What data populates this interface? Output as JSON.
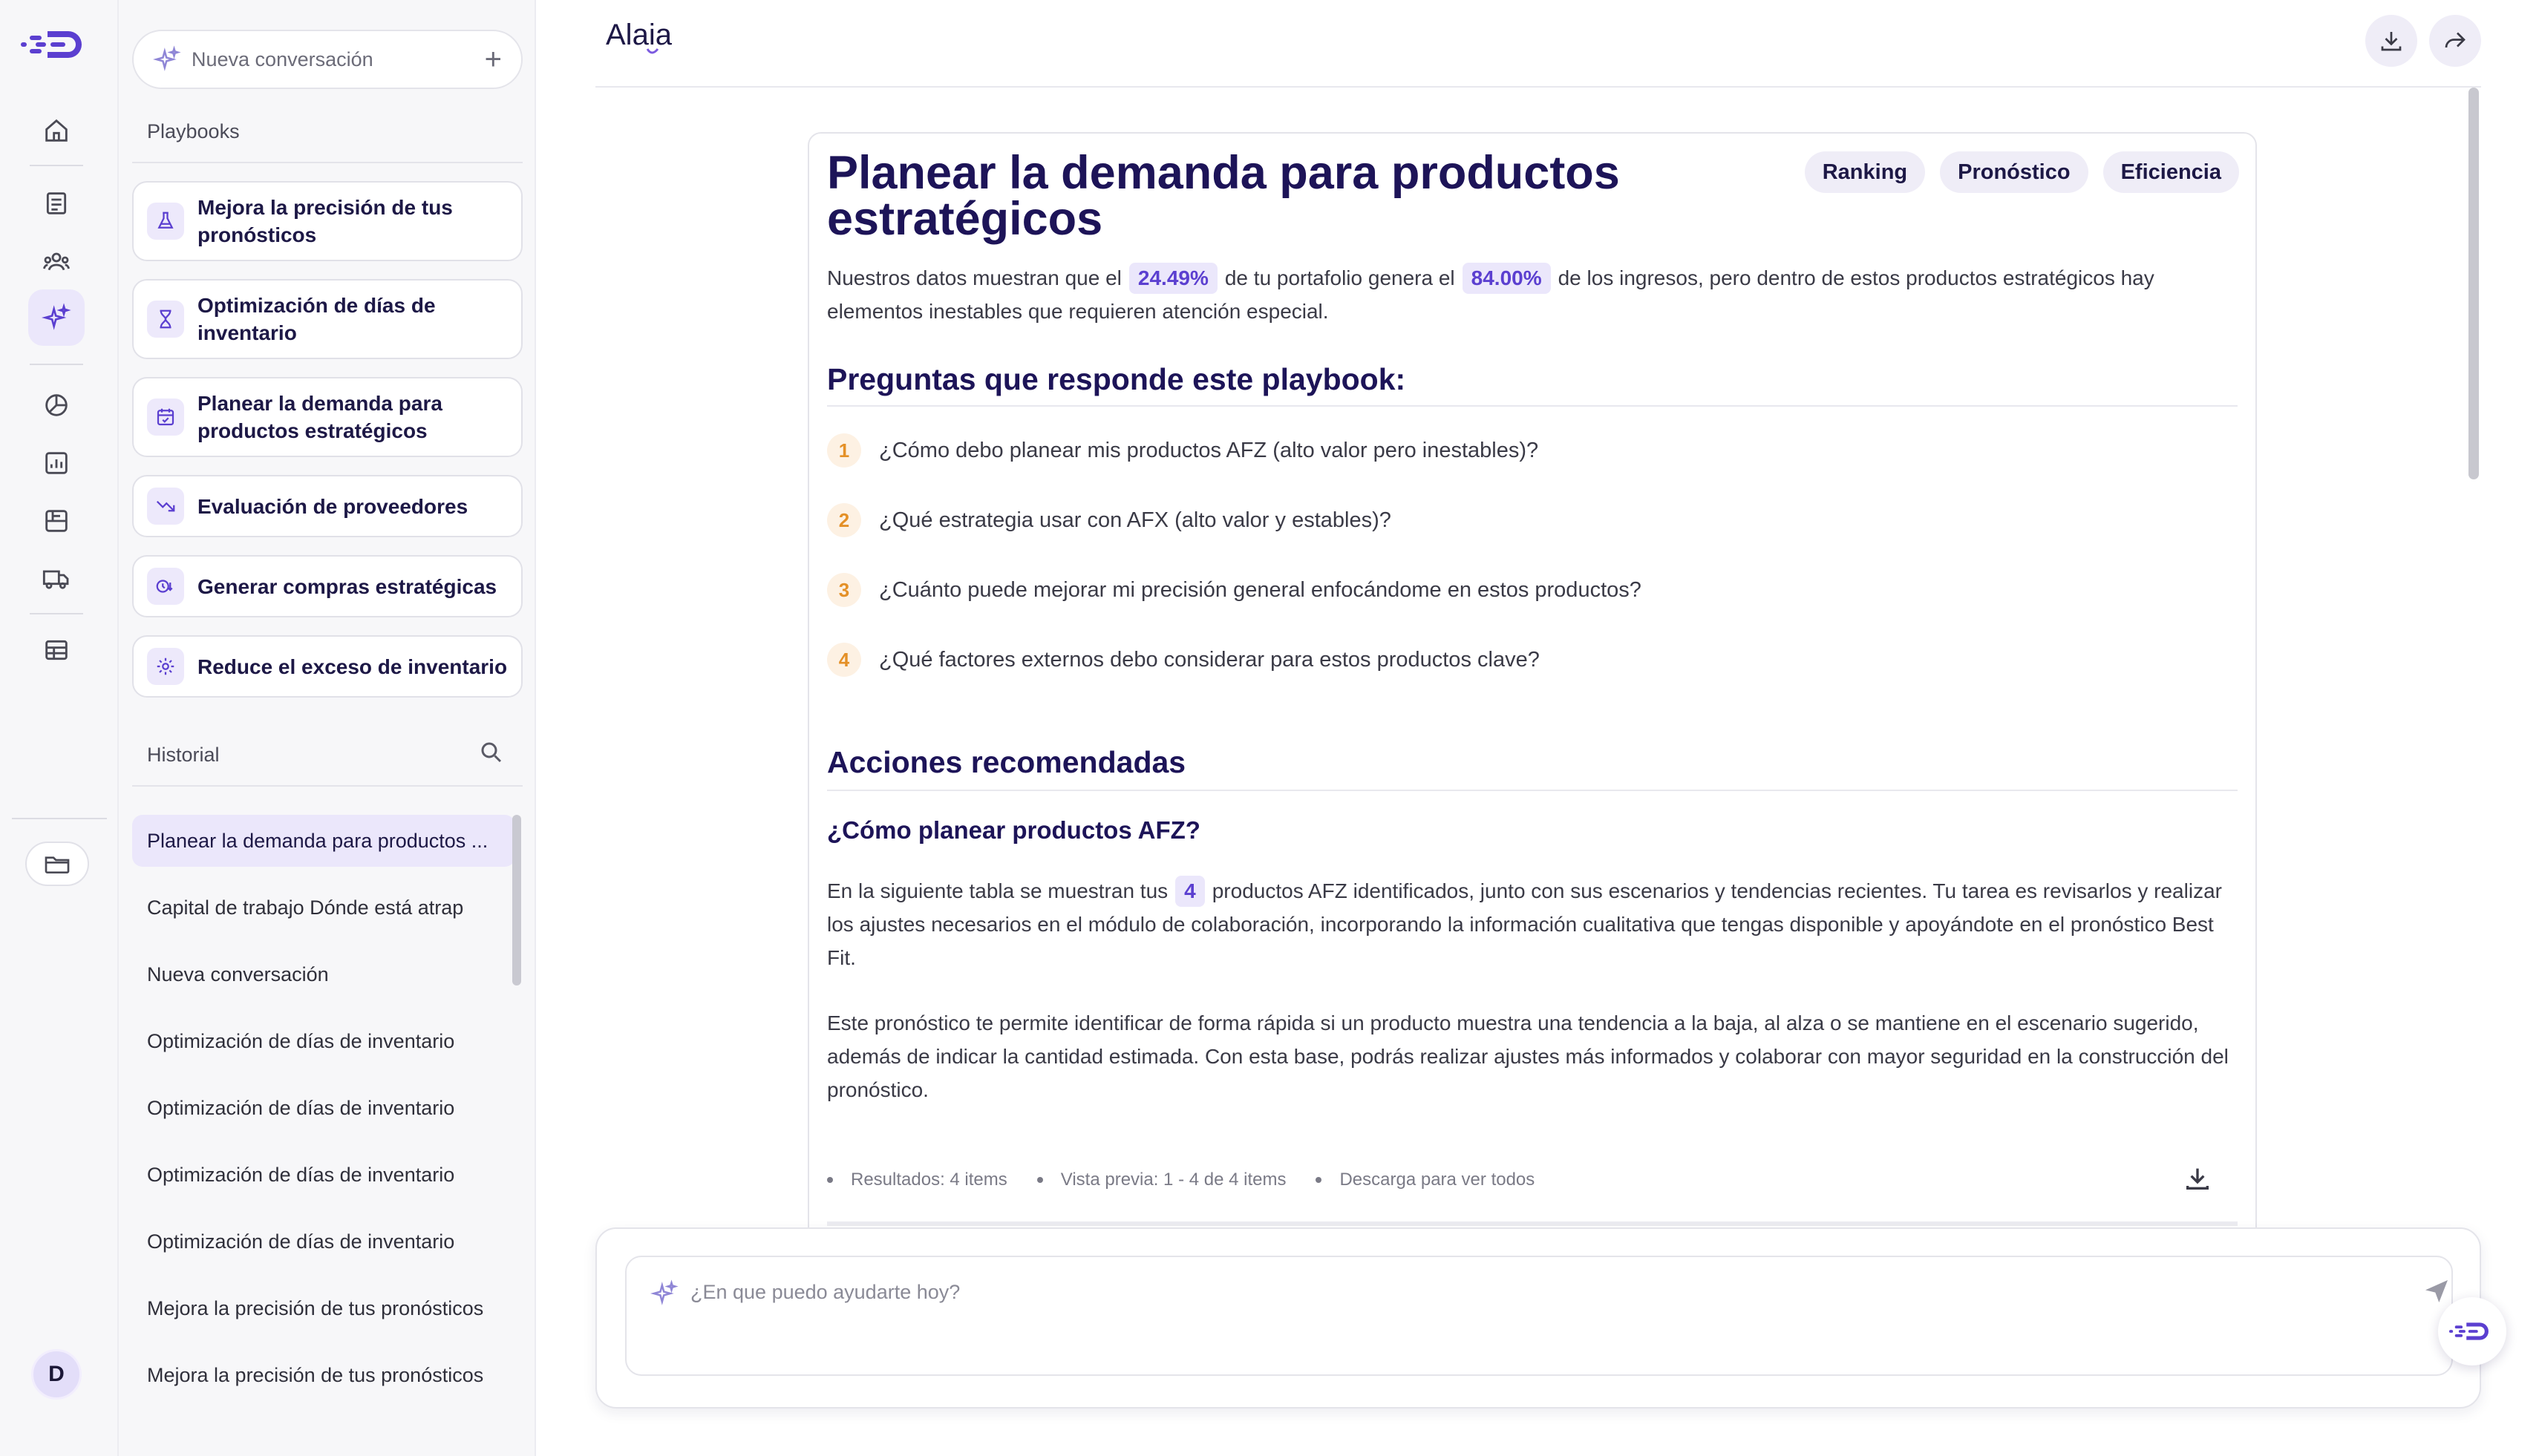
{
  "brand": {
    "app_logo": "Alaia",
    "accent": "#5b3fd0",
    "title_color": "#1d1458"
  },
  "rail": {
    "items": [
      "home-icon",
      "document-icon",
      "users-icon",
      "sparkles-icon",
      "chart-pie-icon",
      "bar-chart-icon",
      "catalog-icon",
      "truck-icon",
      "table-icon"
    ],
    "active": "sparkles-icon",
    "avatar_initial": "D"
  },
  "sidebar": {
    "new_chat_label": "Nueva conversación",
    "playbooks_title": "Playbooks",
    "playbooks": [
      {
        "label": "Mejora la precisión de tus pronósticos",
        "icon": "flask-icon"
      },
      {
        "label": "Optimización de días de inventario",
        "icon": "hourglass-icon"
      },
      {
        "label": "Planear la demanda para productos estratégicos",
        "icon": "calendar-check-icon"
      },
      {
        "label": "Evaluación de proveedores",
        "icon": "trend-down-icon"
      },
      {
        "label": "Generar compras estratégicas",
        "icon": "clock-money-icon"
      },
      {
        "label": "Reduce el exceso de inventario",
        "icon": "gear-icon"
      }
    ],
    "history_title": "Historial",
    "history": [
      "Planear la demanda para productos ...",
      "Capital de trabajo Dónde está atrap",
      "Nueva conversación",
      "Optimización de días de inventario",
      "Optimización de días de inventario",
      "Optimización de días de inventario",
      "Optimización de días de inventario",
      "Mejora la precisión de tus pronósticos",
      "Mejora la precisión de tus pronósticos"
    ]
  },
  "main": {
    "title": "Planear la demanda para productos estratégicos",
    "tags": [
      "Ranking",
      "Pronóstico",
      "Eficiencia"
    ],
    "intro": {
      "p1": "Nuestros datos muestran que el",
      "v1": "24.49%",
      "p2": "de tu portafolio genera el",
      "v2": "84.00%",
      "p3": "de los ingresos, pero dentro de estos productos estratégicos hay elementos inestables que requieren atención especial."
    },
    "questions_title": "Preguntas que responde este playbook:",
    "questions": [
      {
        "num": "1",
        "text": "¿Cómo debo planear mis productos AFZ (alto valor pero inestables)?"
      },
      {
        "num": "2",
        "text": "¿Qué estrategia usar con AFX (alto valor y estables)?"
      },
      {
        "num": "3",
        "text": "¿Cuánto puede mejorar mi precisión general enfocándome en estos productos?"
      },
      {
        "num": "4",
        "text": "¿Qué factores externos debo considerar para estos productos clave?"
      }
    ],
    "actions_title": "Acciones recomendadas",
    "sub_title": "¿Cómo planear productos AFZ?",
    "para1": {
      "pre": "En la siguiente tabla se muestran tus",
      "count": "4",
      "post": "productos AFZ identificados, junto con sus escenarios y tendencias recientes. Tu tarea es revisarlos y realizar los ajustes necesarios en el módulo de colaboración, incorporando la información cualitativa que tengas disponible y apoyándote en el pronóstico Best Fit."
    },
    "para2": "Este pronóstico te permite identificar de forma rápida si un producto muestra una tendencia a la baja, al alza o se mantiene en el escenario sugerido, además de indicar la cantidad estimada. Con esta base, podrás realizar ajustes más informados y colaborar con mayor seguridad en la construcción del pronóstico.",
    "results": {
      "count": "Resultados: 4 items",
      "preview": "Vista previa: 1 - 4 de 4 items",
      "download": "Descarga para ver todos"
    }
  },
  "composer": {
    "placeholder": "¿En que puedo ayudarte hoy?"
  }
}
